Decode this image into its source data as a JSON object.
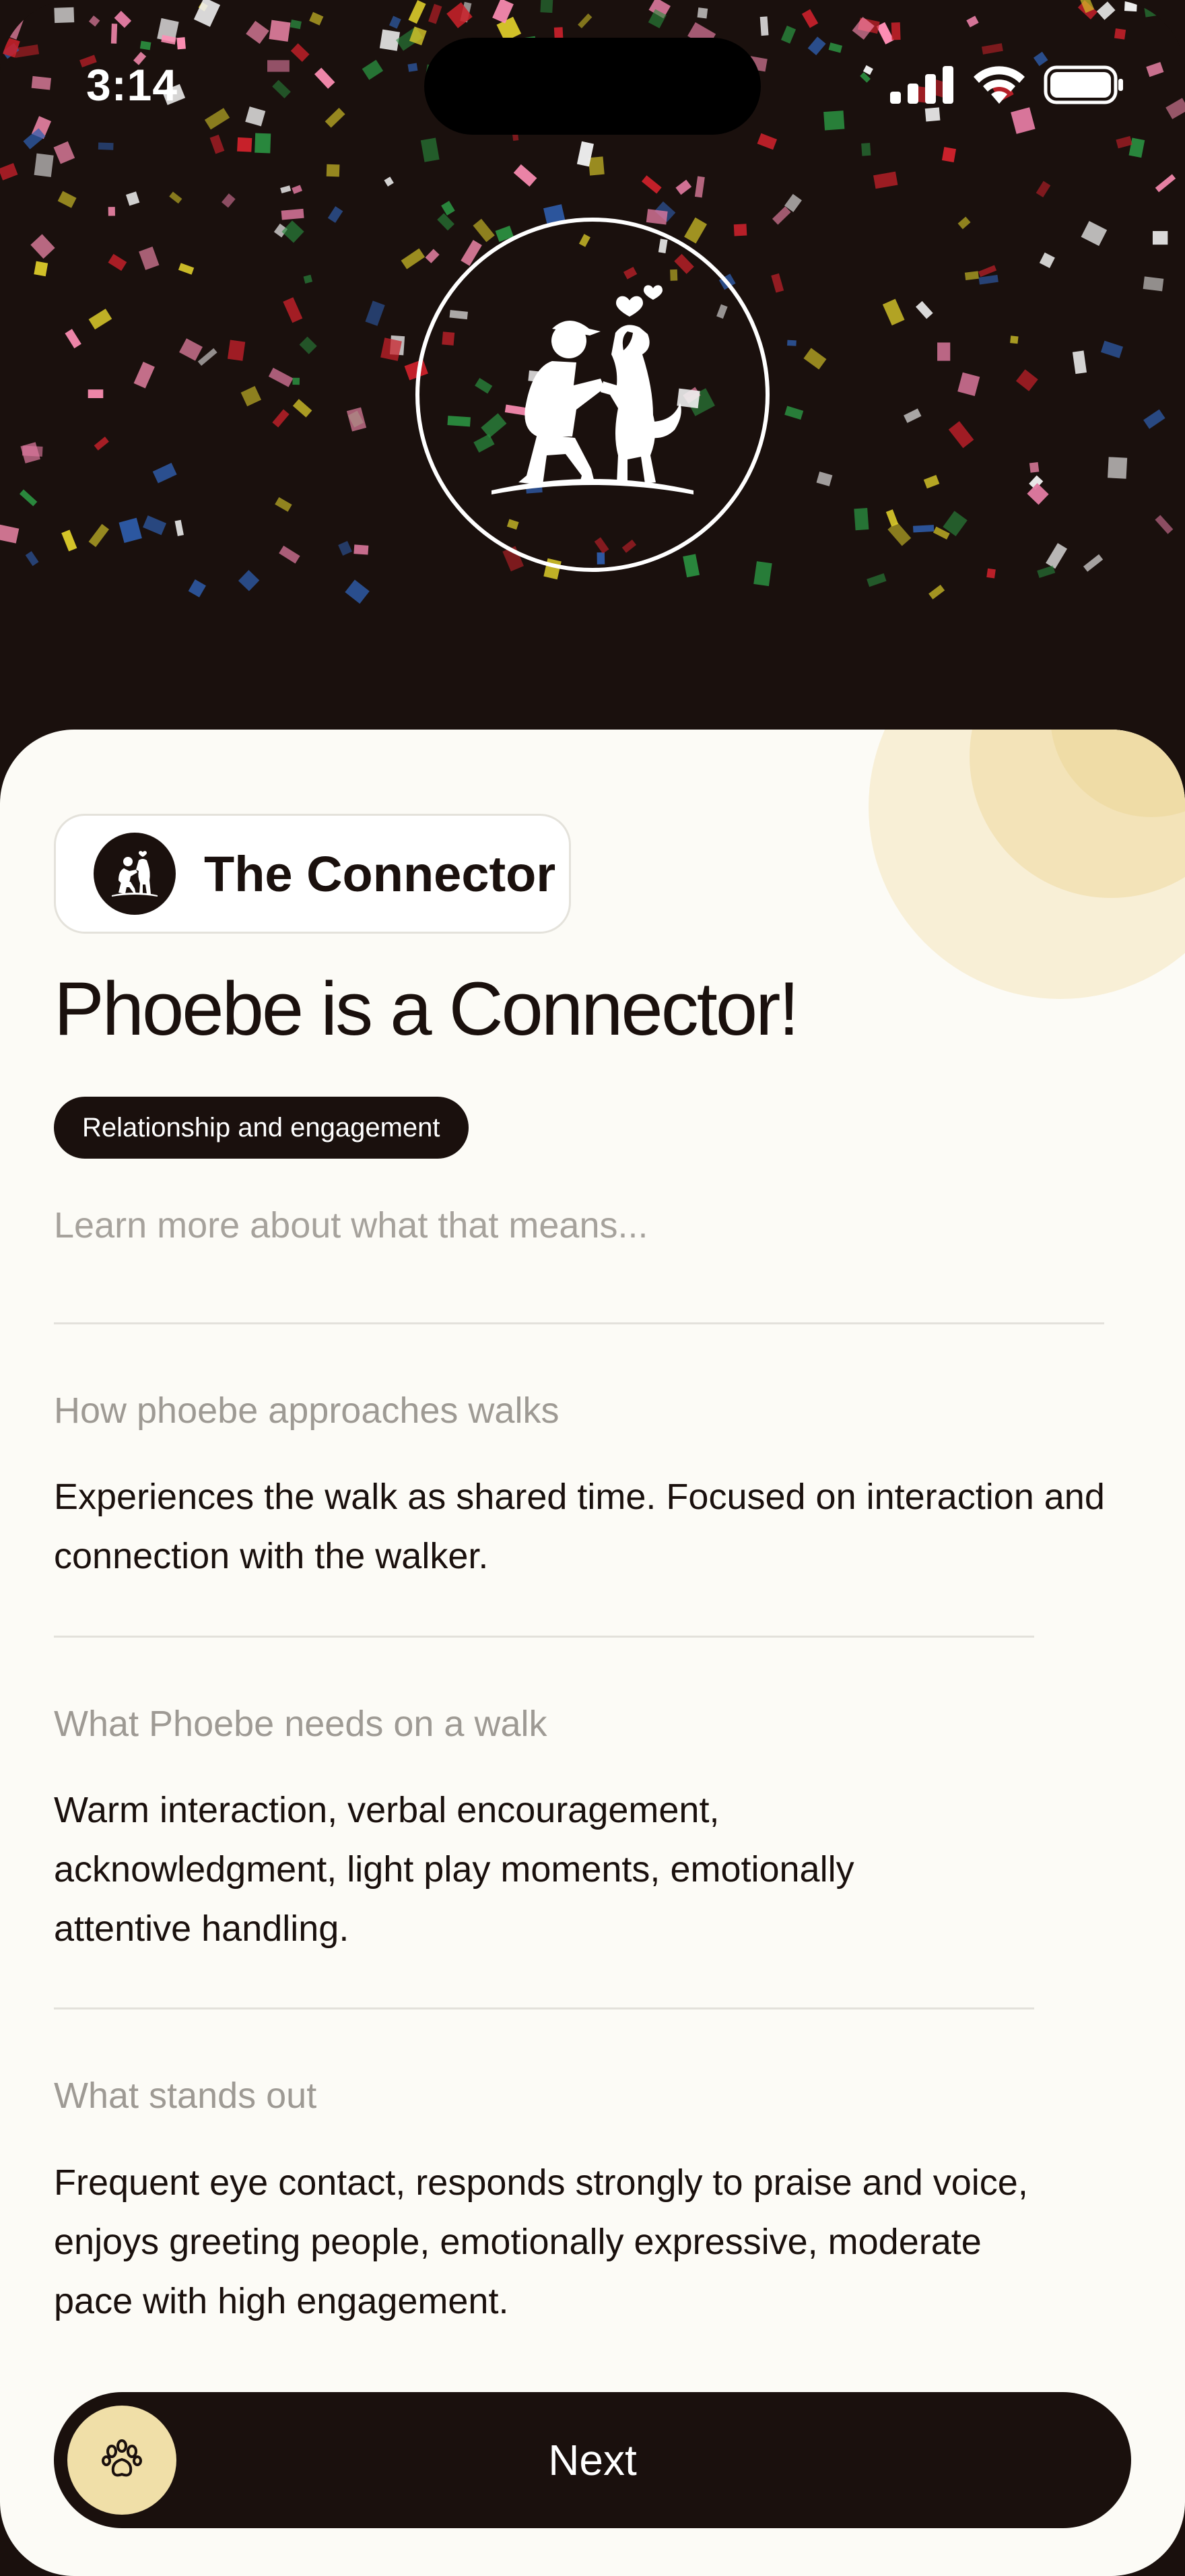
{
  "status_bar": {
    "time": "3:14"
  },
  "hero": {
    "avatar_icon": "person-kneeling-with-dog-icon",
    "confetti_colors": [
      "#c9212b",
      "#2a8a3e",
      "#2f5fb0",
      "#d8c82a",
      "#e07aa0",
      "#f0f0f0",
      "#ff8fb5"
    ]
  },
  "type_chip": {
    "label": "The Connector",
    "icon": "connector-avatar-icon"
  },
  "headline": "Phoebe is a Connector!",
  "tag": "Relationship and engagement",
  "learn_more": "Learn more about what that means...",
  "sections": [
    {
      "label": "How phoebe approaches walks",
      "body": "Experiences the walk as shared time. Focused on interaction and connection with the walker."
    },
    {
      "label": "What Phoebe needs on a walk",
      "body": "Warm interaction, verbal encouragement, acknowledgment, light play moments, emotionally attentive handling."
    },
    {
      "label": "What stands out",
      "body": "Frequent eye contact, responds strongly to praise and voice, enjoys greeting people, emotionally expressive, moderate pace with high engagement."
    }
  ],
  "next_button": {
    "label": "Next",
    "icon": "paw-icon"
  },
  "colors": {
    "dark": "#1a100d",
    "sheet": "#fcfbf6",
    "accent": "#f0dfa8",
    "muted": "#a6a29c"
  }
}
